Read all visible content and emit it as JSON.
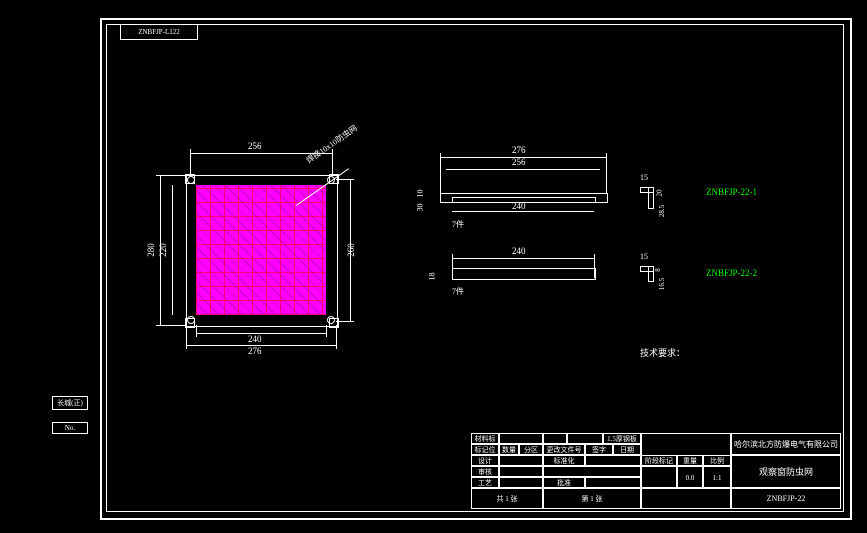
{
  "drawing_number_tab": "ZNBFJP-L122",
  "left_info": {
    "label1": "长城(正)",
    "label2": "No."
  },
  "main_view": {
    "top_dim": "256",
    "bottom_dim_inner": "240",
    "bottom_dim_outer": "276",
    "left_dim_inner": "220",
    "left_dim_outer": "280",
    "right_dim": "260",
    "annotation": "焊接10x10防虫网"
  },
  "section_a": {
    "top_dim_outer": "276",
    "top_dim_mid": "256",
    "bottom_dim": "240",
    "left_small_top": "10",
    "left_small_bot": "30",
    "right_small": "15",
    "right_tiny_top": "20",
    "right_tiny_bot": "28.5",
    "part_label": "ZNBFJP-22-1",
    "note": "7件"
  },
  "section_b": {
    "top_dim": "240",
    "left_dim": "18",
    "right_dim": "15",
    "right_tiny_top": "8",
    "right_tiny_bot": "16.5",
    "part_label": "ZNBFJP-22-2",
    "note": "7件"
  },
  "tech_note": "技术要求：",
  "title_block": {
    "company": "哈尔滨北方防爆电气有限公司",
    "title": "观察窗防虫网",
    "dwg_no": "ZNBFJP-22",
    "rows": {
      "r1c1": "标记位",
      "r1c2": "数量",
      "r1c3": "分区",
      "r1c4": "更改文件号",
      "r1c5": "签字",
      "r1c6": "日期",
      "r2c1": "设计",
      "r2c2": "",
      "r2c3": "标准化",
      "r2c4": "",
      "r2c5": "",
      "r3c1": "审核",
      "r3c2": "",
      "r3c3": "",
      "r3c4": "",
      "r3c5": "",
      "r4c1": "工艺",
      "r4c2": "",
      "r4c3": "批准",
      "r4c4": "",
      "r4c5": ""
    },
    "mid": {
      "stage": "阶段标记",
      "weight": "重量",
      "scale": "比例",
      "stage_v": "",
      "weight_v": "0.0",
      "scale_v": "1:1",
      "sheet": "共 1 张",
      "sheet2": "第 1 张"
    },
    "material_label": "材料标记",
    "material": "1.5厚钢板"
  }
}
